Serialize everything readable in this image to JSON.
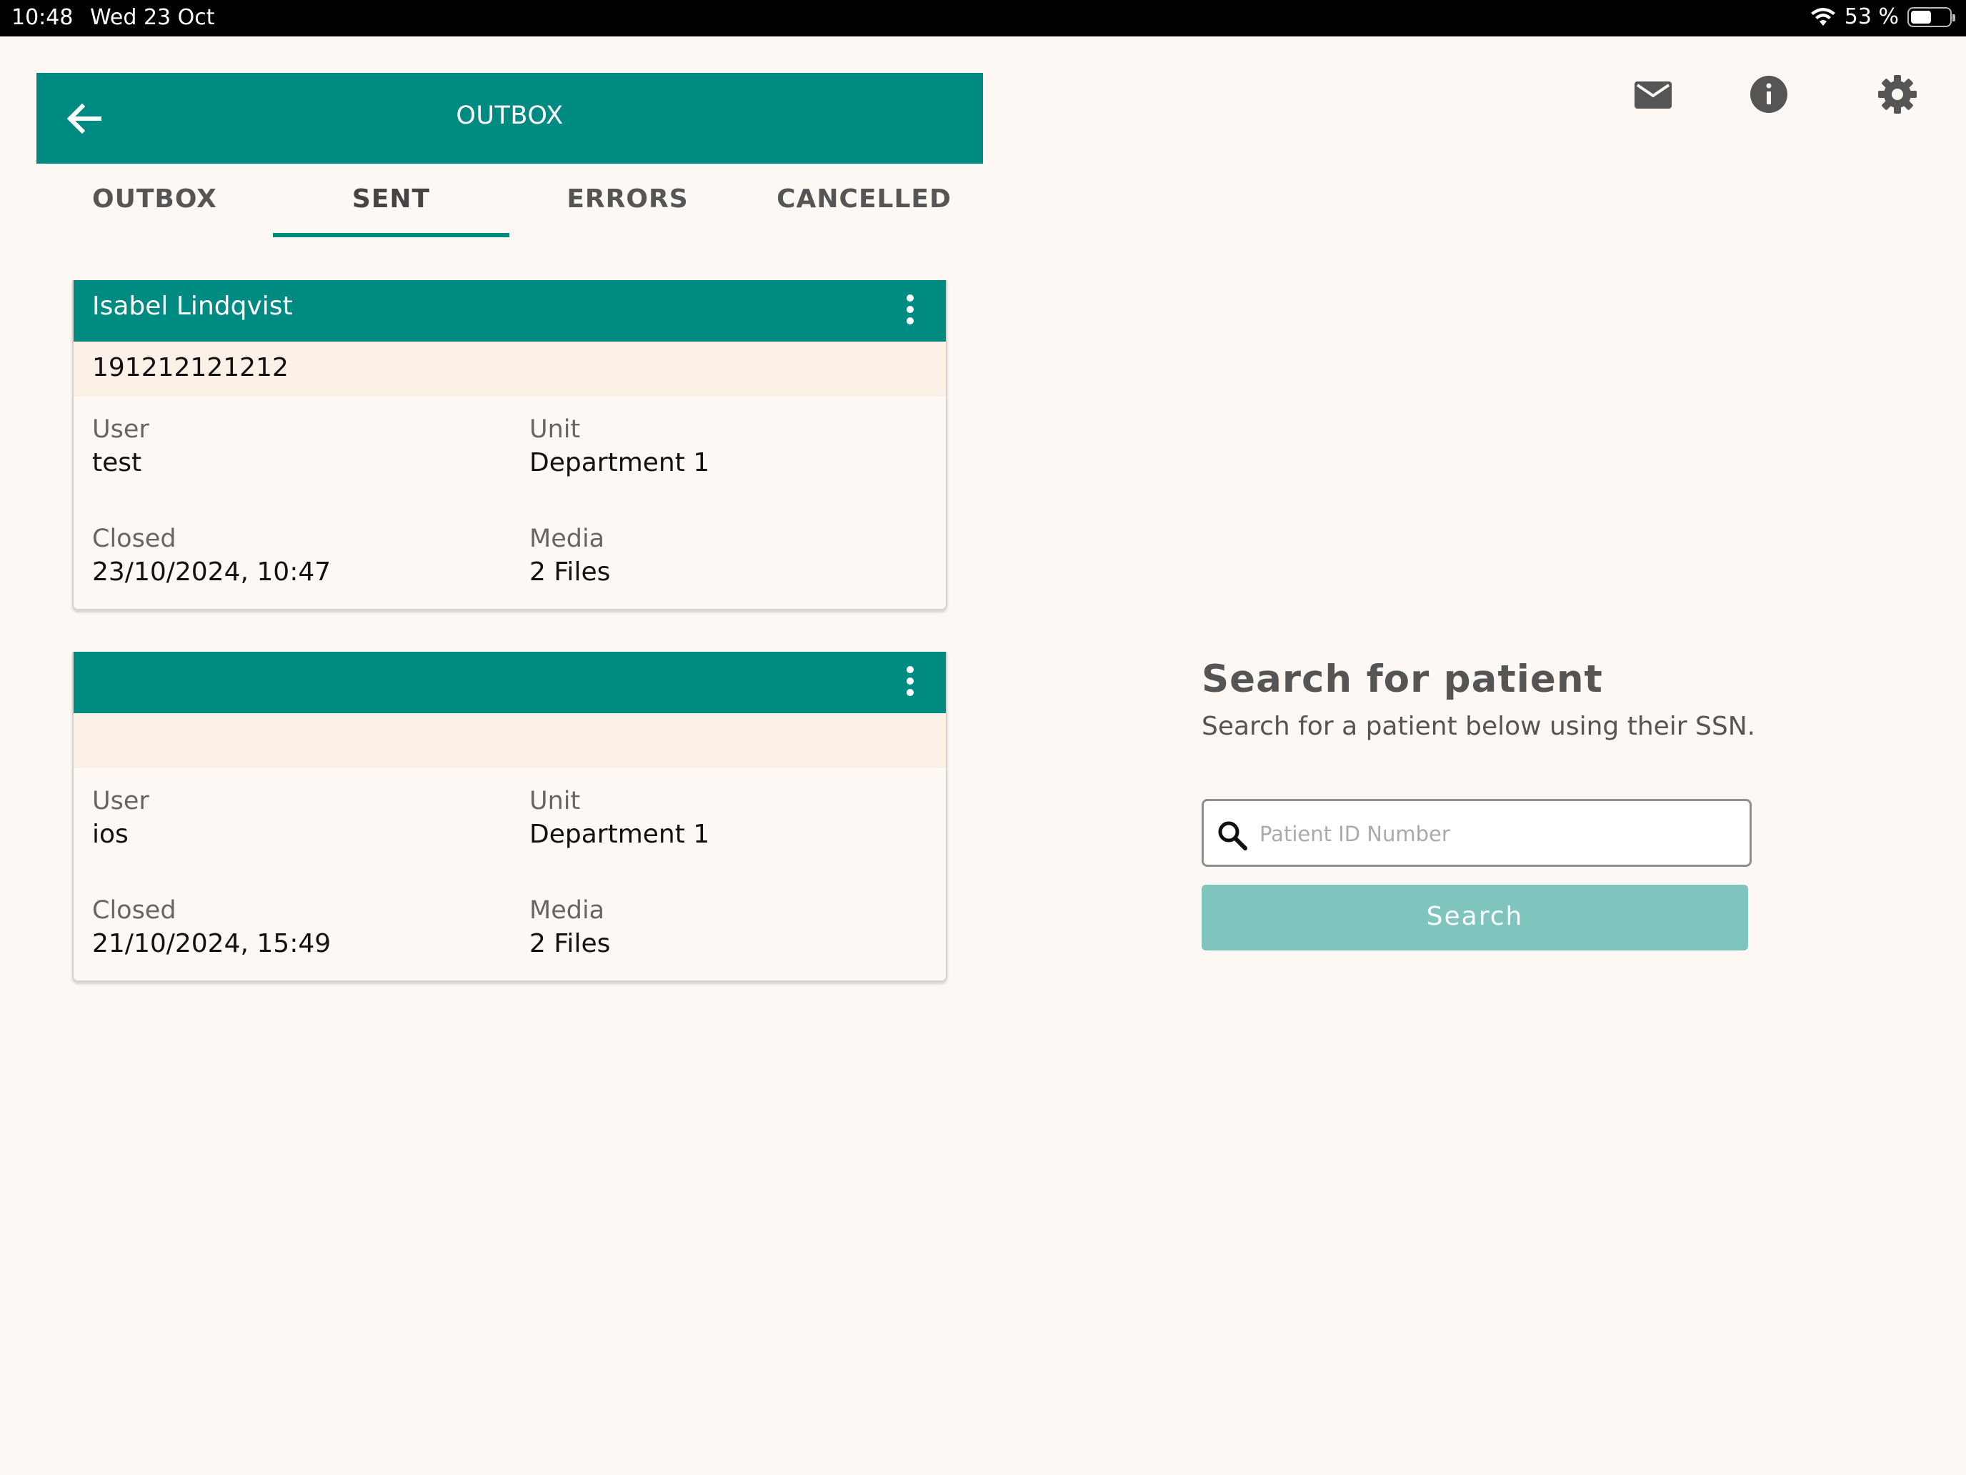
{
  "status_bar": {
    "time": "10:48",
    "date": "Wed 23 Oct",
    "battery": "53 %",
    "battery_level": 0.53
  },
  "app_bar": {
    "title": "OUTBOX"
  },
  "tabs": [
    {
      "label": "OUTBOX",
      "active": false
    },
    {
      "label": "SENT",
      "active": true
    },
    {
      "label": "ERRORS",
      "active": false
    },
    {
      "label": "CANCELLED",
      "active": false
    }
  ],
  "cards": [
    {
      "name": "Isabel Lindqvist",
      "ssn": "191212121212",
      "user_label": "User",
      "user": "test",
      "unit_label": "Unit",
      "unit": "Department 1",
      "closed_label": "Closed",
      "closed": "23/10/2024, 10:47",
      "media_label": "Media",
      "media": "2 Files"
    },
    {
      "name": "",
      "ssn": "",
      "user_label": "User",
      "user": "ios",
      "unit_label": "Unit",
      "unit": "Department 1",
      "closed_label": "Closed",
      "closed": "21/10/2024, 15:49",
      "media_label": "Media",
      "media": "2 Files"
    }
  ],
  "search": {
    "title": "Search for patient",
    "subtitle": "Search for a patient below using their SSN.",
    "placeholder": "Patient ID Number",
    "button_label": "Search"
  },
  "colors": {
    "primary": "#008b82",
    "background": "#fdf8f3",
    "button_disabled": "#7fc4bd"
  },
  "top_icons": [
    "mail-icon",
    "info-icon",
    "settings-icon"
  ]
}
